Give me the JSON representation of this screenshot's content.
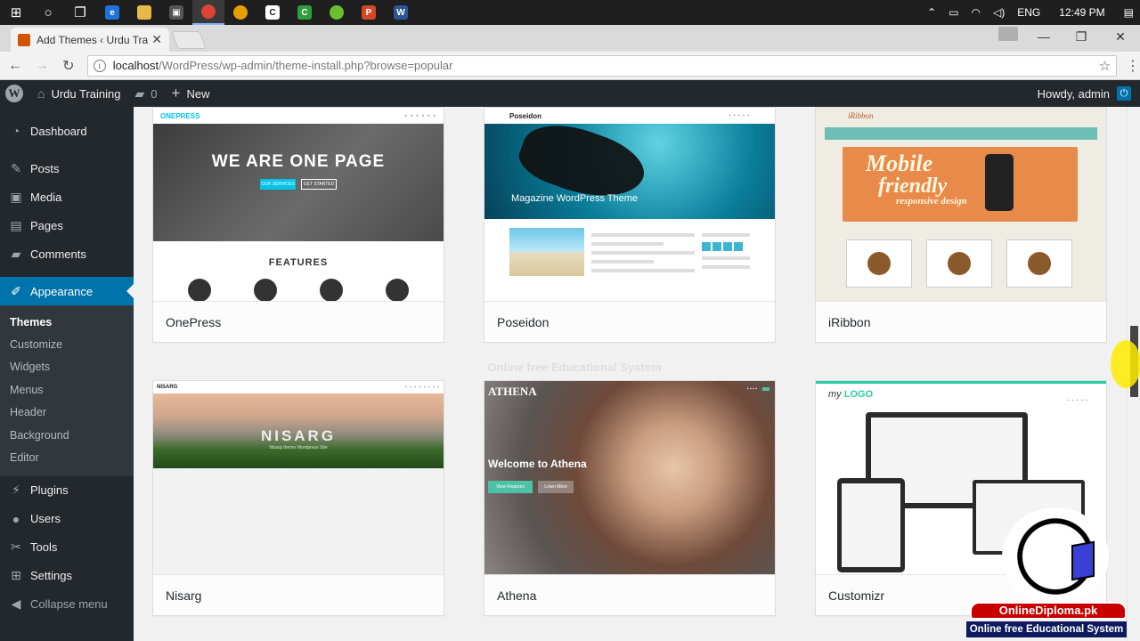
{
  "taskbar": {
    "icons": [
      "windows-icon",
      "cortana-icon",
      "task-view-icon",
      "edge-icon",
      "file-explorer-icon",
      "store-icon",
      "chrome-icon",
      "app-icon",
      "app-icon-2",
      "camtasia-icon",
      "app-icon-3",
      "powerpoint-icon",
      "word-icon"
    ],
    "language": "ENG",
    "time": "12:49 PM"
  },
  "browser": {
    "tab_title": "Add Themes ‹ Urdu Training",
    "url_host": "localhost",
    "url_path": "/WordPress/wp-admin/theme-install.php?browse=popular"
  },
  "adminbar": {
    "site_name": "Urdu Training",
    "comments_count": "0",
    "new_label": "New",
    "howdy": "Howdy, admin"
  },
  "sidebar": {
    "items": [
      {
        "label": "Dashboard",
        "icon": "dashboard-icon"
      },
      {
        "label": "Posts",
        "icon": "pin-icon"
      },
      {
        "label": "Media",
        "icon": "media-icon"
      },
      {
        "label": "Pages",
        "icon": "pages-icon"
      },
      {
        "label": "Comments",
        "icon": "comments-icon"
      },
      {
        "label": "Appearance",
        "icon": "brush-icon"
      }
    ],
    "submenu": [
      "Themes",
      "Customize",
      "Widgets",
      "Menus",
      "Header",
      "Background",
      "Editor"
    ],
    "items_after": [
      {
        "label": "Plugins",
        "icon": "plug-icon"
      },
      {
        "label": "Users",
        "icon": "user-icon"
      },
      {
        "label": "Tools",
        "icon": "wrench-icon"
      },
      {
        "label": "Settings",
        "icon": "settings-icon"
      }
    ],
    "collapse_label": "Collapse menu"
  },
  "themes": [
    {
      "name": "OnePress",
      "hero_title": "WE ARE ONE PAGE",
      "section_title": "FEATURES",
      "logo": "ONEPRESS",
      "btn1": "OUR SERVICES",
      "btn2": "GET STARTED"
    },
    {
      "name": "Poseidon",
      "logo": "Poseidon",
      "hero_title": "Magazine WordPress Theme"
    },
    {
      "name": "iRibbon",
      "logo": "iRibbon",
      "banner_l1": "Mobile",
      "banner_l2": "friendly",
      "banner_l3": "responsive design"
    },
    {
      "name": "Nisarg",
      "logo": "NISARG",
      "hero_title": "NISARG",
      "hero_sub": "Nisarg theme Wordpress Site"
    },
    {
      "name": "Athena",
      "logo": "ATHENA",
      "welcome": "Welcome to Athena",
      "btn1": "View Features",
      "btn2": "Learn More"
    },
    {
      "name": "Customizr",
      "logo_prefix": "my",
      "logo_word": "LOGO"
    }
  ],
  "watermark": {
    "line1": "OnlineDiploma.pk",
    "line2": "Online free Educational System"
  },
  "colors": {
    "admin_bar": "#23282d",
    "active_menu": "#0073aa",
    "page_bg": "#f1f1f1"
  }
}
